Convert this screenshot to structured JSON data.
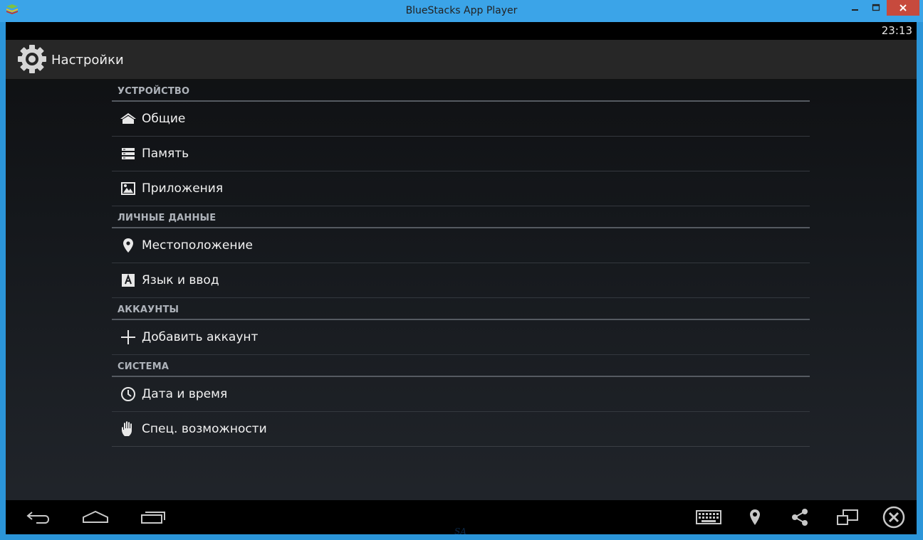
{
  "window": {
    "title": "BlueStacks App Player"
  },
  "status_bar": {
    "time": "23:13"
  },
  "action_bar": {
    "title": "Настройки",
    "icon": "settings-gear-icon"
  },
  "sections": [
    {
      "header": "УСТРОЙСТВО",
      "items": [
        {
          "label": "Общие",
          "icon": "home-icon"
        },
        {
          "label": "Память",
          "icon": "storage-icon"
        },
        {
          "label": "Приложения",
          "icon": "apps-icon"
        }
      ]
    },
    {
      "header": "ЛИЧНЫЕ ДАННЫЕ",
      "items": [
        {
          "label": "Местоположение",
          "icon": "location-pin-icon"
        },
        {
          "label": "Язык и ввод",
          "icon": "language-icon"
        }
      ]
    },
    {
      "header": "АККАУНТЫ",
      "items": [
        {
          "label": "Добавить аккаунт",
          "icon": "plus-icon"
        }
      ]
    },
    {
      "header": "СИСТЕМА",
      "items": [
        {
          "label": "Дата и время",
          "icon": "clock-icon"
        },
        {
          "label": "Спец. возможности",
          "icon": "hand-icon"
        }
      ]
    }
  ],
  "nav_bar": {
    "left": [
      "back-icon",
      "home-outline-icon",
      "recent-apps-icon"
    ],
    "right": [
      "keyboard-icon",
      "location-icon",
      "share-icon",
      "screens-icon",
      "close-circle-icon"
    ]
  },
  "watermark": "SA",
  "colors": {
    "window_frame": "#3ba4e8",
    "close_button": "#c74a3d",
    "section_header_text": "#aeb3ba",
    "row_text": "#f2f2f2"
  }
}
